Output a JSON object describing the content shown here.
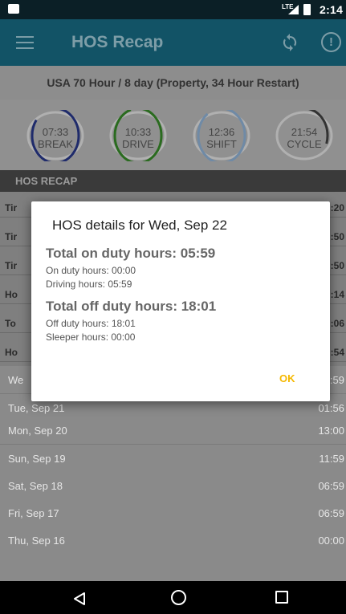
{
  "status_bar": {
    "network": "LTE",
    "time": "2:14"
  },
  "app_bar": {
    "title": "HOS Recap",
    "menu_icon": "hamburger-menu-icon",
    "sync_icon": "sync-icon",
    "alert_icon": "alert-icon"
  },
  "ruleset": "USA 70 Hour / 8 day (Property, 34 Hour Restart)",
  "gauges": [
    {
      "time": "07:33",
      "label": "BREAK",
      "color": "#1f2b6b",
      "fraction": 0.85
    },
    {
      "time": "10:33",
      "label": "DRIVE",
      "color": "#2a6b1f",
      "fraction": 0.95
    },
    {
      "time": "12:36",
      "label": "SHIFT",
      "color": "#6f8aa6",
      "fraction": 0.9
    },
    {
      "time": "21:54",
      "label": "CYCLE",
      "color": "#333333",
      "fraction": 0.3
    }
  ],
  "section_header": "HOS RECAP",
  "summary_rows": [
    {
      "label": "Tir",
      "value": ":20"
    },
    {
      "label": "Tir",
      "value": ":50"
    },
    {
      "label": "Tir",
      "value": ":50"
    },
    {
      "label": "Ho",
      "value": ":14"
    },
    {
      "label": "To",
      "value": ":06"
    },
    {
      "label": "Ho",
      "value": ":54"
    }
  ],
  "days": [
    {
      "label": "We",
      "value": ":59"
    },
    {
      "label": "Tue, Sep 21",
      "value": "01:56"
    },
    {
      "label": "Mon, Sep 20",
      "value": "13:00"
    },
    {
      "label": "Sun, Sep 19",
      "value": "11:59"
    },
    {
      "label": "Sat, Sep 18",
      "value": "06:59"
    },
    {
      "label": "Fri, Sep 17",
      "value": "06:59"
    },
    {
      "label": "Thu, Sep 16",
      "value": "00:00"
    }
  ],
  "dialog": {
    "title": "HOS details for Wed, Sep 22",
    "on_duty_header": "Total on duty hours: 05:59",
    "on_duty_line": "On duty hours: 00:00",
    "driving_line": "Driving hours: 05:59",
    "off_duty_header": "Total off duty hours: 18:01",
    "off_duty_line": "Off duty hours: 18:01",
    "sleeper_line": "Sleeper hours: 00:00",
    "ok_label": "OK"
  }
}
